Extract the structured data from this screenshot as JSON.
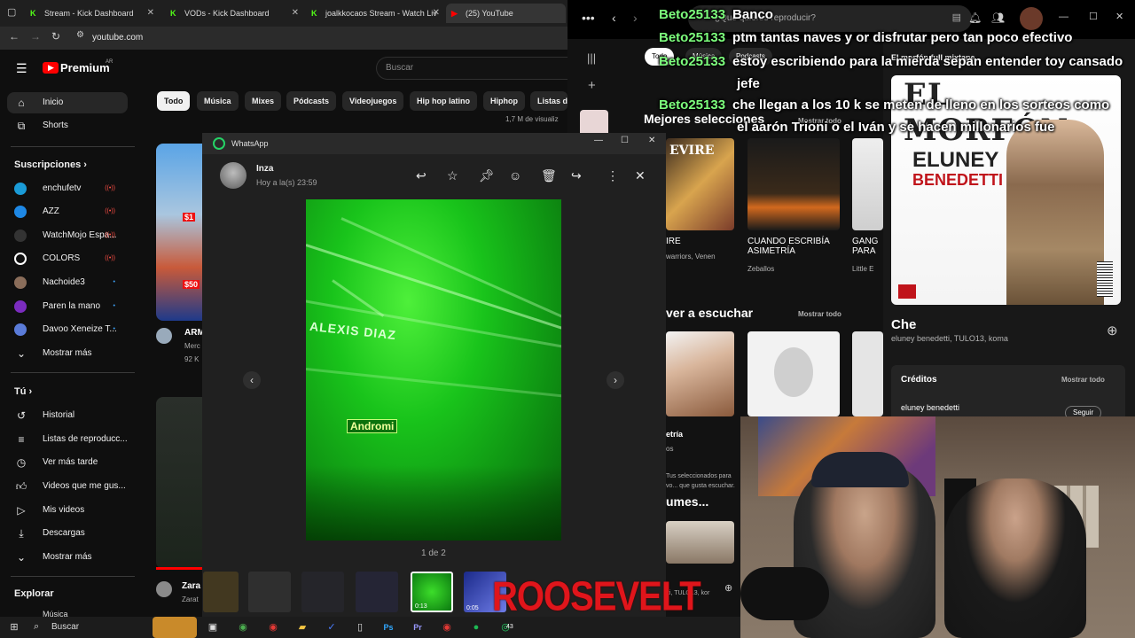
{
  "browser": {
    "tabs": [
      {
        "title": "Stream - Kick Dashboard",
        "icon": "K"
      },
      {
        "title": "VODs - Kick Dashboard",
        "icon": "K"
      },
      {
        "title": "joalkkocaos Stream - Watch Liv",
        "icon": "K"
      },
      {
        "title": "(25) YouTube",
        "icon": "▶"
      }
    ],
    "url": "youtube.com"
  },
  "youtube": {
    "logo": "Premium",
    "logo_region": "AR",
    "search_placeholder": "Buscar",
    "chips": [
      "Todo",
      "Música",
      "Mixes",
      "Pódcasts",
      "Videojuegos",
      "Hip hop latino",
      "Hiphop",
      "Listas d"
    ],
    "views_snippet": "1,7 M de visualiz",
    "nav": [
      {
        "label": "Inicio",
        "icon": "home-icon"
      },
      {
        "label": "Shorts",
        "icon": "shorts-icon"
      }
    ],
    "subs_heading": "Suscripciones",
    "subscriptions": [
      {
        "label": "enchufetv",
        "color": "#1a9bd7"
      },
      {
        "label": "AZZ",
        "color": "#1e88e5"
      },
      {
        "label": "WatchMojo Espa...",
        "color": "#222222"
      },
      {
        "label": "COLORS",
        "color": "#ffffff"
      },
      {
        "label": "Nachoide3",
        "color": "#8a6d5a"
      },
      {
        "label": "Paren la mano",
        "color": "#7b2cbf"
      },
      {
        "label": "Davoo Xeneize T...",
        "color": "#5a7bd8"
      }
    ],
    "more_subs": "Mostrar más",
    "you_heading": "Tú",
    "you_items": [
      "Historial",
      "Listas de reproducc...",
      "Ver más tarde",
      "Videos que me gus...",
      "Mis videos",
      "Descargas"
    ],
    "more_you": "Mostrar más",
    "explore_heading": "Explorar",
    "explore_item": "Música",
    "video_title_snippet": "ARM",
    "video_meta_1": "Merc",
    "video_meta_2": "92 K",
    "video2_title": "Zara",
    "video2_meta": "Zarat"
  },
  "whatsapp": {
    "app_title": "WhatsApp",
    "sender": "Inza",
    "timestamp": "Hoy a la(s) 23:59",
    "counter": "1 de 2",
    "photo_text_1": "ALEXIS DIAZ",
    "photo_text_2": "Andromi",
    "thumb_dur_1": "0:13",
    "thumb_dur_2": "0:05"
  },
  "spotify": {
    "search_placeholder": "¿Qué quieres reproducir?",
    "filters": [
      "Todo",
      "Música",
      "Podcasts"
    ],
    "section1": "Mejores selecciones",
    "section1_more": "Mostrar todo",
    "cards1": [
      {
        "title": "IRE",
        "sub": "warriors, Venen"
      },
      {
        "title": "CUANDO ESCRIBÍA ASIMETRÍA",
        "sub": "Zeballos"
      },
      {
        "title": "GANG PARA",
        "sub": "Little E"
      }
    ],
    "section2": "ver a escuchar",
    "section2_more": "Mostrar todo",
    "cards2": [
      {
        "title": "etría",
        "sub": "os"
      },
      {
        "title": "",
        "sub": ""
      }
    ],
    "section2_note": "Tus seleccionados para vo... que gusta escuchar.",
    "section3": "umes...",
    "row_snippet": "tti, TULO13, kor",
    "album_mixtape_label": "El morfón full mixtape",
    "album_title": "EL MORFÓN",
    "album_artist_line1": "ELUNEY",
    "album_artist_line2": "BENEDETTI",
    "track_title": "Che",
    "track_artists": "eluney benedetti, TULO13, koma",
    "credits_heading": "Créditos",
    "credits_more": "Mostrar todo",
    "credit_name": "eluney benedetti",
    "follow_label": "Seguir"
  },
  "chat": [
    {
      "user": "Beto25133",
      "msg": "Banco"
    },
    {
      "user": "Beto25133",
      "msg": "ptm tantas naves y or disfrutar pero tan poco efectivo"
    },
    {
      "user": "Beto25133",
      "msg": "estoy escribiendo para la mierda sepan entender toy cansado"
    },
    {
      "user": "",
      "msg": "jefe"
    },
    {
      "user": "Beto25133",
      "msg": "che llegan a los 10 k se meten de lleno en los sorteos como"
    },
    {
      "user": "",
      "msg": "el aarón Trioni o el Iván y se hacen millonarios fue"
    }
  ],
  "overlay_text": "ROOSEVELT",
  "taskbar": {
    "search_label": "Buscar",
    "badge": "43"
  },
  "colors": {
    "yt_red": "#ff0000",
    "kick_green": "#53fc18",
    "chat_user": "#7dff7d",
    "laser_green": "#19c41b",
    "overlay_red": "#e0151b"
  }
}
